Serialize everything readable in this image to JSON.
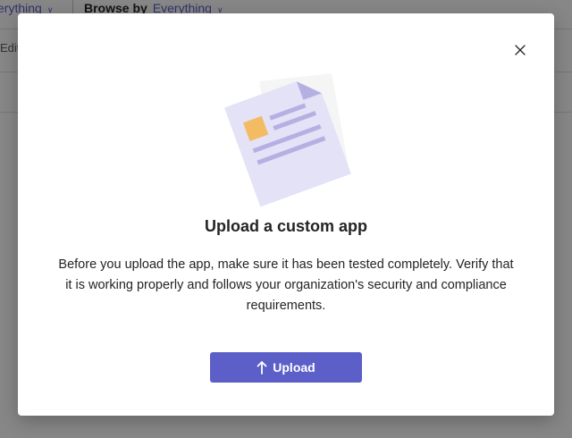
{
  "background": {
    "filter1_value": "Everything",
    "filter1_clipped": "erything",
    "browse_label": "Browse by",
    "browse_value": "Everything",
    "edit_clipped": "Edit"
  },
  "dialog": {
    "title": "Upload a custom app",
    "description": "Before you upload the app, make sure it has been tested completely. Verify that it is working properly and follows your organization's security and compliance requirements.",
    "upload_label": "Upload",
    "close_icon": "close-icon",
    "upload_icon": "arrow-up-icon"
  },
  "colors": {
    "accent": "#5b5fc7",
    "text": "#252423",
    "overlay": "rgba(0,0,0,0.47)",
    "doc_fill": "#e3e2f7",
    "doc_lines": "#b4b1e2",
    "doc_square": "#f4bb63"
  }
}
